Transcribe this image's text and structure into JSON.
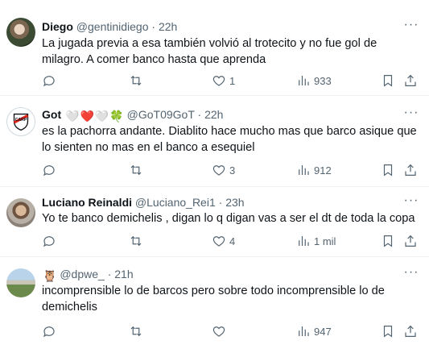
{
  "tweets": [
    {
      "name": "Diego",
      "handle": "@gentinidiego",
      "dot": "·",
      "time": "22h",
      "text": "La jugada previa a esa también volvió al trotecito y no fue gol de milagro. A comer banco hasta que aprenda",
      "replies": "",
      "retweets": "",
      "likes": "1",
      "views": "933"
    },
    {
      "name": "Got",
      "name_emojis": [
        "🤍",
        "❤️",
        "🤍",
        "🍀"
      ],
      "handle": "@GoT09GoT",
      "dot": "·",
      "time": "22h",
      "text": "es la pachorra andante. Diablito hace mucho mas que barco asique que lo sienten no mas en el banco a esequiel",
      "replies": "",
      "retweets": "",
      "likes": "3",
      "views": "912"
    },
    {
      "name": "Luciano Reinaldi",
      "handle": "@Luciano_Rei1",
      "dot": "·",
      "time": "23h",
      "text": "Yo te banco demichelis , digan lo q digan vas a ser el dt de toda la copa",
      "replies": "",
      "retweets": "",
      "likes": "4",
      "views": "1 mil"
    },
    {
      "name": "",
      "name_emojis": [
        "🦉"
      ],
      "handle": "@dpwe_",
      "dot": "·",
      "time": "21h",
      "text": "incomprensible lo de barcos pero sobre todo incomprensible lo de demichelis",
      "replies": "",
      "retweets": "",
      "likes": "",
      "views": "947"
    }
  ],
  "icons": {
    "reply": "reply-icon",
    "retweet": "retweet-icon",
    "like": "heart-icon",
    "views": "views-icon",
    "bookmark": "bookmark-icon",
    "share": "share-icon",
    "more": "more-icon"
  },
  "colors": {
    "text": "#0f1419",
    "secondary": "#536471",
    "divider": "#eff3f4",
    "river_red": "#e2231a"
  }
}
